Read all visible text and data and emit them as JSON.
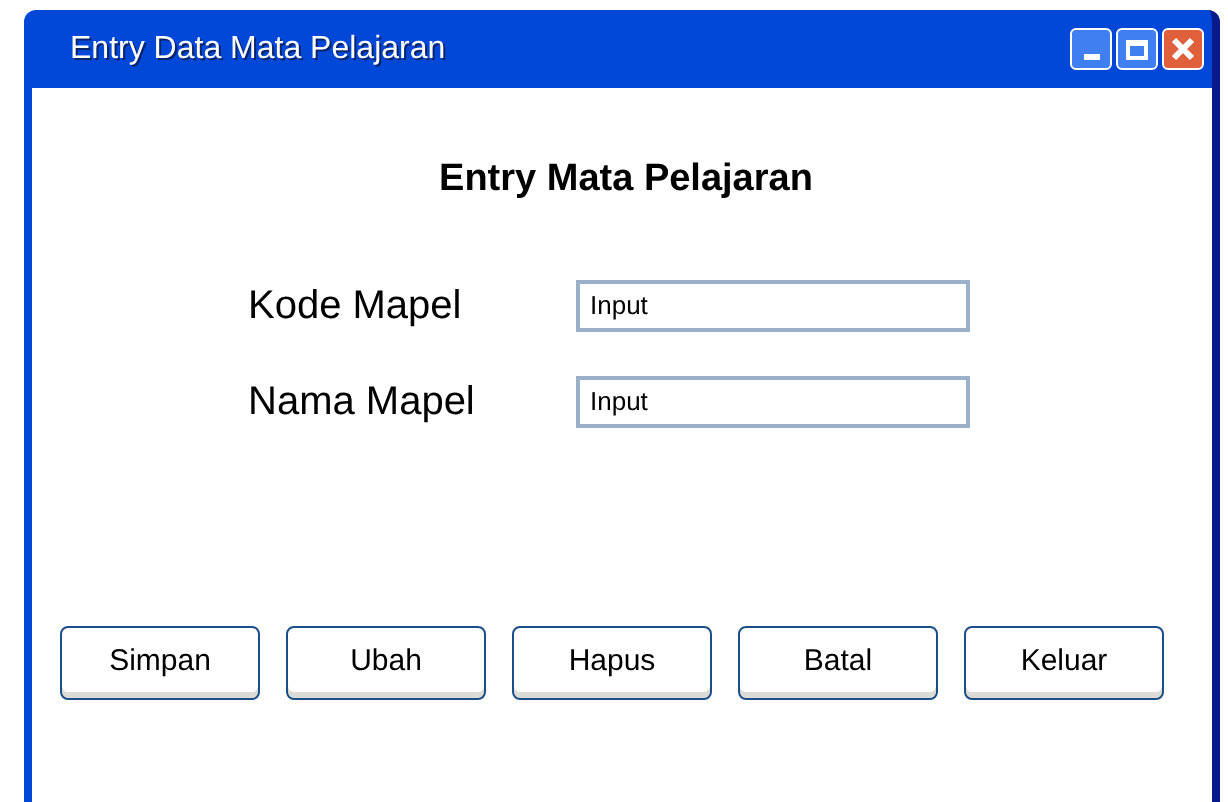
{
  "window": {
    "title": "Entry Data Mata Pelajaran"
  },
  "heading": "Entry Mata Pelajaran",
  "fields": [
    {
      "label": "Kode Mapel",
      "value": "Input"
    },
    {
      "label": "Nama Mapel",
      "value": "Input"
    }
  ],
  "buttons": [
    "Simpan",
    "Ubah",
    "Hapus",
    "Batal",
    "Keluar"
  ]
}
